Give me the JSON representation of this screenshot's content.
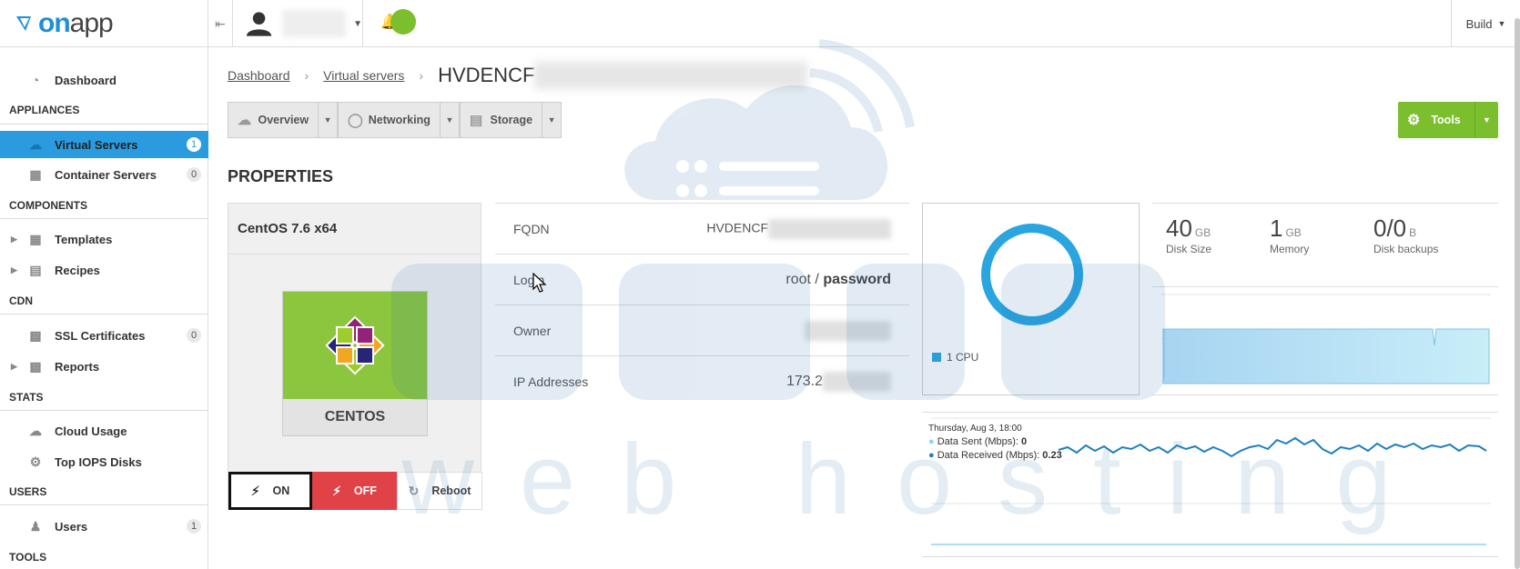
{
  "brand": {
    "logo_on": "on",
    "logo_app": "app"
  },
  "topbar": {
    "build_label": "Build"
  },
  "sidebar": {
    "dashboard": "Dashboard",
    "sections": [
      "APPLIANCES",
      "COMPONENTS",
      "CDN",
      "STATS",
      "USERS",
      "TOOLS"
    ],
    "items": [
      {
        "label": "Virtual Servers",
        "badge": "1"
      },
      {
        "label": "Container Servers",
        "badge": "0"
      },
      {
        "label": "Templates"
      },
      {
        "label": "Recipes"
      },
      {
        "label": "SSL Certificates",
        "badge": "0"
      },
      {
        "label": "Reports"
      },
      {
        "label": "Cloud Usage"
      },
      {
        "label": "Top IOPS Disks"
      },
      {
        "label": "Users",
        "badge": "1"
      }
    ]
  },
  "breadcrumb": {
    "home": "Dashboard",
    "section": "Virtual servers",
    "title": "HVDENCF"
  },
  "tabs": [
    "Overview",
    "Networking",
    "Storage"
  ],
  "tools_label": "Tools",
  "properties_title": "PROPERTIES",
  "os": {
    "title": "CentOS 7.6 x64",
    "name": "CENTOS"
  },
  "power": {
    "on": "ON",
    "off": "OFF",
    "reboot": "Reboot"
  },
  "info": {
    "fqdn_label": "FQDN",
    "fqdn_value": "HVDENCF",
    "login_label": "Login",
    "login_user": "root",
    "login_sep": " / ",
    "login_pass": "password",
    "owner_label": "Owner",
    "ip_label": "IP Addresses",
    "ip_value": "173.2"
  },
  "cpu": {
    "legend": "1 CPU",
    "color": "#2aa5e0"
  },
  "stats": {
    "disk": {
      "num": "40",
      "unit": "GB",
      "label": "Disk Size"
    },
    "memory": {
      "num": "1",
      "unit": "GB",
      "label": "Memory"
    },
    "backups": {
      "num": "0/0",
      "unit": "B",
      "label": "Disk backups"
    }
  },
  "network_tooltip": {
    "date": "Thursday, Aug 3, 18:00",
    "sent_label": "Data Sent (Mbps):",
    "sent_value": "0",
    "received_label": "Data Received (Mbps):",
    "received_value": "0.23"
  },
  "watermark": {
    "text": "web hosting"
  },
  "colors": {
    "accent": "#2b9be0",
    "success": "#7cbf2e",
    "danger": "#e04247"
  }
}
